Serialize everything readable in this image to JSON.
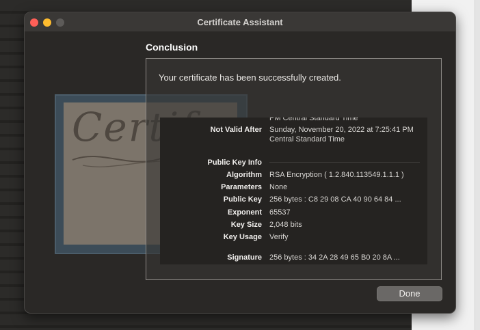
{
  "window": {
    "title": "Certificate Assistant"
  },
  "artwork": {
    "text": "Certif"
  },
  "section_title": "Conclusion",
  "message": "Your certificate has been successfully created.",
  "details": {
    "clipped_top": "PM Central Standard Time",
    "not_valid_after": {
      "label": "Not Valid After",
      "value": "Sunday, November 20, 2022 at 7:25:41 PM Central Standard Time"
    },
    "public_key_header": "Public Key Info",
    "algorithm": {
      "label": "Algorithm",
      "value": "RSA Encryption ( 1.2.840.113549.1.1.1 )"
    },
    "parameters": {
      "label": "Parameters",
      "value": "None"
    },
    "public_key": {
      "label": "Public Key",
      "value": "256 bytes : C8 29 08 CA 40 90 64 84 ..."
    },
    "exponent": {
      "label": "Exponent",
      "value": "65537"
    },
    "key_size": {
      "label": "Key Size",
      "value": "2,048 bits"
    },
    "key_usage": {
      "label": "Key Usage",
      "value": "Verify"
    },
    "signature": {
      "label": "Signature",
      "value": "256 bytes : 34 2A 28 49 65 B0 20 8A ..."
    }
  },
  "buttons": {
    "done": "Done"
  },
  "colors": {
    "close": "#fe5f57",
    "minimize": "#febc2e",
    "zoom_disabled": "#5d5b59",
    "window_bg": "#2a2826"
  }
}
